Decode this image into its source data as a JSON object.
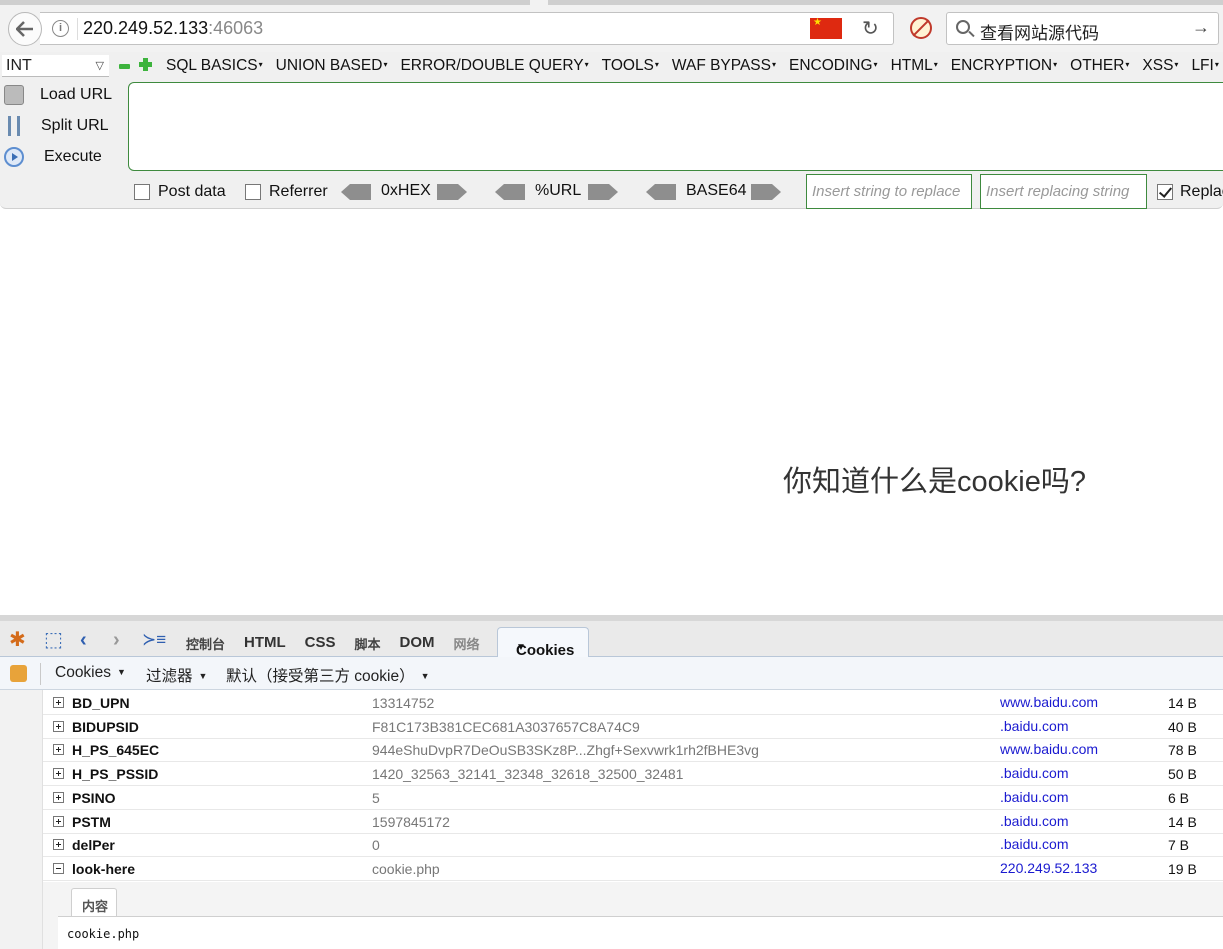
{
  "browser": {
    "url_host": "220.249.52.133",
    "url_port": ":46063",
    "search_text": "查看网站源代码"
  },
  "hackbar": {
    "type_select": "INT",
    "menu": [
      "SQL BASICS",
      "UNION BASED",
      "ERROR/DOUBLE QUERY",
      "TOOLS",
      "WAF BYPASS",
      "ENCODING",
      "HTML",
      "ENCRYPTION",
      "OTHER",
      "XSS",
      "LFI"
    ],
    "buttons": {
      "load_url": "Load URL",
      "split_url": "Split URL",
      "execute": "Execute"
    },
    "options": {
      "post_data": "Post data",
      "referrer": "Referrer",
      "hex": "0xHEX",
      "url": "%URL",
      "base64": "BASE64",
      "replace_placeholder": "Insert string to replace",
      "replacing_placeholder": "Insert replacing string",
      "replace_all": "Replace All"
    }
  },
  "page": {
    "heading": "你知道什么是cookie吗?"
  },
  "firebug": {
    "tabs": {
      "console": "控制台",
      "html": "HTML",
      "css": "CSS",
      "script": "脚本",
      "dom": "DOM",
      "net": "网络",
      "cookies": "Cookies"
    },
    "subbar": {
      "cookies": "Cookies",
      "filter": "过滤器",
      "default": "默认（接受第三方 cookie）"
    },
    "cookies": [
      {
        "name": "BD_UPN",
        "value": "13314752",
        "domain": "www.baidu.com",
        "size": "14 B",
        "expanded": false
      },
      {
        "name": "BIDUPSID",
        "value": "F81C173B381CEC681A3037657C8A74C9",
        "domain": ".baidu.com",
        "size": "40 B",
        "expanded": false
      },
      {
        "name": "H_PS_645EC",
        "value": "944eShuDvpR7DeOuSB3SKz8P...Zhgf+Sexvwrk1rh2fBHE3vg",
        "domain": "www.baidu.com",
        "size": "78 B",
        "expanded": false
      },
      {
        "name": "H_PS_PSSID",
        "value": "1420_32563_32141_32348_32618_32500_32481",
        "domain": ".baidu.com",
        "size": "50 B",
        "expanded": false
      },
      {
        "name": "PSINO",
        "value": "5",
        "domain": ".baidu.com",
        "size": "6 B",
        "expanded": false
      },
      {
        "name": "PSTM",
        "value": "1597845172",
        "domain": ".baidu.com",
        "size": "14 B",
        "expanded": false
      },
      {
        "name": "delPer",
        "value": "0",
        "domain": ".baidu.com",
        "size": "7 B",
        "expanded": false
      },
      {
        "name": "look-here",
        "value": "cookie.php",
        "domain": "220.249.52.133",
        "size": "19 B",
        "expanded": true
      }
    ],
    "detail": {
      "tab": "内容",
      "content": "cookie.php"
    }
  }
}
